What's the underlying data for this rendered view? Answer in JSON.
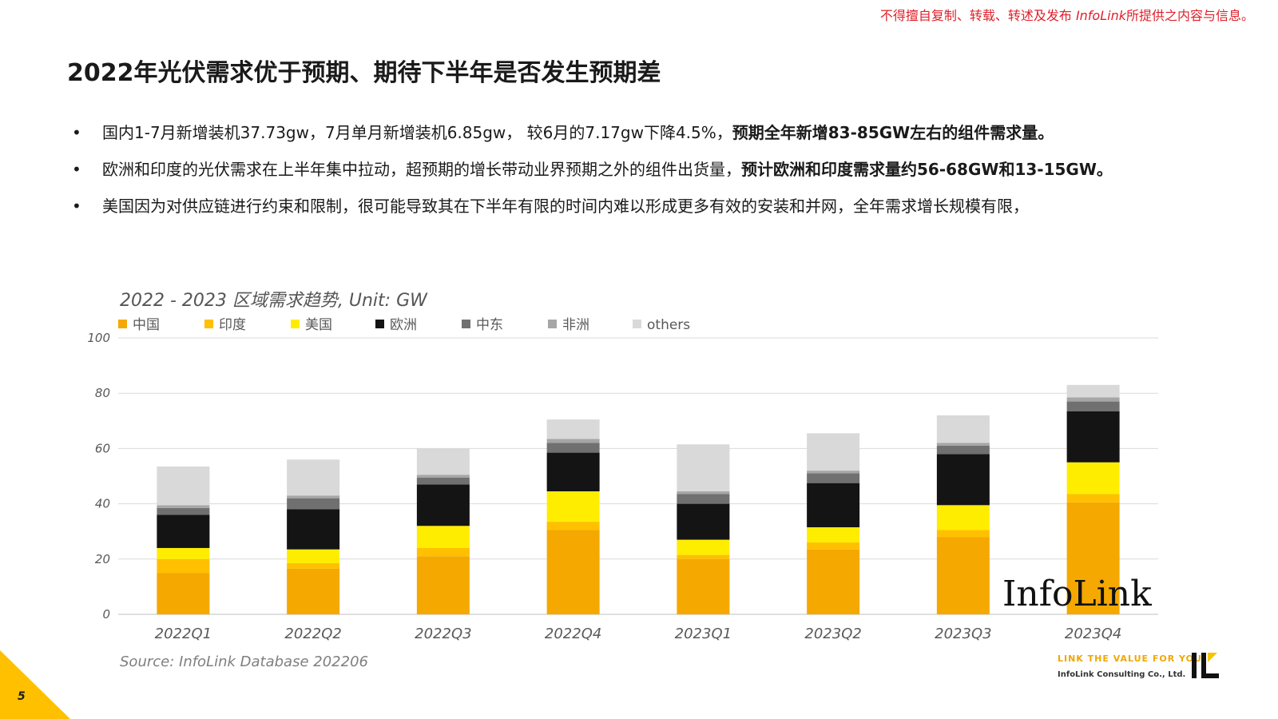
{
  "header": {
    "copyright_prefix": "不得擅自复制、转载、转述及发布",
    "copyright_brand": "InfoLink",
    "copyright_suffix": "所提供之内容与信息。"
  },
  "title": "2022年光伏需求优于预期、期待下半年是否发生预期差",
  "bullets": [
    {
      "normal": "国内1-7月新增装机37.73gw，7月单月新增装机6.85gw， 较6月的7.17gw下降4.5%，",
      "bold": "预期全年新增83-85GW左右的组件需求量。"
    },
    {
      "normal": "欧洲和印度的光伏需求在上半年集中拉动，超预期的增长带动业界预期之外的组件出货量，",
      "bold": "预计欧洲和印度需求量约56-68GW和13-15GW。"
    },
    {
      "normal": "美国因为对供应链进行约束和限制，很可能导致其在下半年有限的时间内难以形成更多有效的安装和并网，全年需求增长规模有限，",
      "bold": ""
    }
  ],
  "chart_data": {
    "type": "bar",
    "stacked": true,
    "title": "2022 - 2023 区域需求趋势, Unit: GW",
    "categories": [
      "2022Q1",
      "2022Q2",
      "2022Q3",
      "2022Q4",
      "2023Q1",
      "2023Q2",
      "2023Q3",
      "2023Q4"
    ],
    "ylim": [
      0,
      100
    ],
    "yticks": [
      0,
      20,
      40,
      60,
      80,
      100
    ],
    "grid": true,
    "legend_position": "top-left",
    "series": [
      {
        "name": "中国",
        "color": "#f5a800",
        "values": [
          15,
          16.5,
          21,
          30.5,
          20,
          23.5,
          28,
          40.5
        ]
      },
      {
        "name": "印度",
        "color": "#ffc000",
        "values": [
          5,
          2,
          3,
          3,
          1.5,
          2.5,
          2.5,
          3
        ]
      },
      {
        "name": "美国",
        "color": "#ffed00",
        "values": [
          4,
          5,
          8,
          11,
          5.5,
          5.5,
          9,
          11.5
        ]
      },
      {
        "name": "欧洲",
        "color": "#141414",
        "values": [
          12,
          14.5,
          15,
          14,
          13,
          16,
          18.5,
          18.5
        ]
      },
      {
        "name": "中东",
        "color": "#707070",
        "values": [
          2.5,
          4,
          2.5,
          3.5,
          3.5,
          3.5,
          3,
          3.5
        ]
      },
      {
        "name": "非洲",
        "color": "#a6a6a6",
        "values": [
          1,
          1,
          1,
          1.5,
          1,
          1,
          1,
          1.5
        ]
      },
      {
        "name": "others",
        "color": "#d9d9d9",
        "values": [
          14,
          13,
          9.5,
          7,
          17,
          13.5,
          10,
          4.5
        ]
      }
    ]
  },
  "source": "Source: InfoLink Database 202206",
  "page_number": "5",
  "brand": {
    "watermark": "InfoLink",
    "slogan": "LINK THE VALUE FOR YOU",
    "company": "InfoLink Consulting Co., Ltd."
  }
}
